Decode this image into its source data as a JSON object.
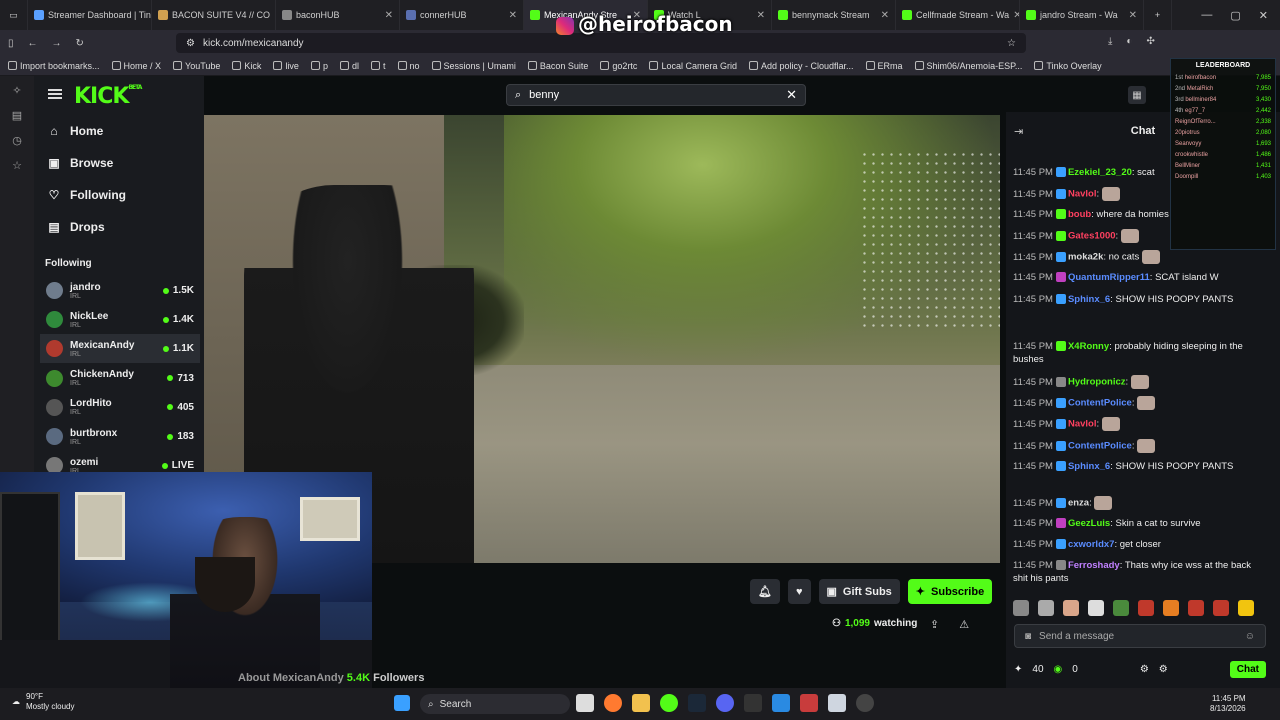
{
  "browser": {
    "tabs": [
      {
        "label": "Streamer Dashboard | Tinko",
        "color": "#5aa0ff"
      },
      {
        "label": "BACON SUITE V4 // CO",
        "color": "#d0a050"
      },
      {
        "label": "baconHUB",
        "color": "#888"
      },
      {
        "label": "connerHUB",
        "color": "#5a6fb0"
      },
      {
        "label": "MexicanAndy Stre",
        "color": "#53fc18"
      },
      {
        "label": "Watch L",
        "color": "#53fc18"
      },
      {
        "label": "bennymack Stream",
        "color": "#53fc18"
      },
      {
        "label": "Cellfmade Stream - Wa",
        "color": "#53fc18"
      },
      {
        "label": "jandro Stream - Wa",
        "color": "#53fc18"
      }
    ],
    "url": "kick.com/mexicanandy",
    "bookmarks": [
      "Import bookmarks...",
      "Home / X",
      "YouTube",
      "Kick",
      "live",
      "p",
      "dl",
      "t",
      "no",
      "Sessions | Umami",
      "Bacon Suite",
      "go2rtc",
      "Local Camera Grid",
      "Add policy - Cloudflar...",
      "ERma",
      "Shim06/Anemoia-ESP...",
      "Tinko Overlay"
    ]
  },
  "overlay": {
    "handle": "@heirofbacon"
  },
  "kick": {
    "logo": "KICK",
    "logo_tag": "BETA",
    "nav": [
      {
        "label": "Home",
        "icon": "home-icon",
        "glyph": "⌂"
      },
      {
        "label": "Browse",
        "icon": "browse-icon",
        "glyph": "▣"
      },
      {
        "label": "Following",
        "icon": "heart-icon",
        "glyph": "♡"
      },
      {
        "label": "Drops",
        "icon": "drops-icon",
        "glyph": "▤"
      }
    ],
    "following_title": "Following",
    "following": [
      {
        "name": "jandro",
        "cat": "IRL",
        "viewers": "1.5K",
        "color": "#6f7c8c"
      },
      {
        "name": "NickLee",
        "cat": "IRL",
        "viewers": "1.4K",
        "color": "#2f8a3c"
      },
      {
        "name": "MexicanAndy",
        "cat": "IRL",
        "viewers": "1.1K",
        "color": "#b03a2e"
      },
      {
        "name": "ChickenAndy",
        "cat": "IRL",
        "viewers": "713",
        "color": "#3d8a2e"
      },
      {
        "name": "LordHito",
        "cat": "IRL",
        "viewers": "405",
        "color": "#555"
      },
      {
        "name": "burtbronx",
        "cat": "IRL",
        "viewers": "183",
        "color": "#5a6a80"
      },
      {
        "name": "ozemi",
        "cat": "IRL",
        "viewers": "LIVE",
        "color": "#777"
      }
    ],
    "search_value": "benny",
    "actions": {
      "gift": "Gift Subs",
      "subscribe": "Subscribe"
    },
    "watching": "1,099",
    "watching_label": "watching",
    "about": "About MexicanAndy",
    "followers_count": "5.4K",
    "followers_label": "Followers"
  },
  "chat": {
    "title": "Chat",
    "messages": [
      {
        "time": "11:45 PM",
        "badge": "#3aa0ff",
        "user": "Ezekiel_23_20",
        "color": "#53fc18",
        "text": "scat",
        "emote": false
      },
      {
        "time": "11:45 PM",
        "badge": "#3aa0ff",
        "user": "Navlol",
        "color": "#ff4060",
        "text": "",
        "emote": true
      },
      {
        "time": "11:45 PM",
        "badge": "#53fc18",
        "user": "boub",
        "color": "#ff4060",
        "text": "where da homies",
        "emote": false
      },
      {
        "time": "11:45 PM",
        "badge": "#53fc18",
        "user": "Gates1000",
        "color": "#ff4060",
        "text": "",
        "emote": true
      },
      {
        "time": "11:45 PM",
        "badge": "#3aa0ff",
        "user": "moka2k",
        "color": "#dddddd",
        "text": "no cats",
        "emote": true
      },
      {
        "time": "11:45 PM",
        "badge": "#c040c0",
        "user": "QuantumRipper11",
        "color": "#5a8cff",
        "text": "SCAT island W",
        "emote": false
      },
      {
        "time": "11:45 PM",
        "badge": "#3aa0ff",
        "user": "Sphinx_6",
        "color": "#5a8cff",
        "text": "SHOW HIS POOPY PANTS",
        "emote": false
      },
      {
        "time": "11:45 PM",
        "badge": "#53fc18",
        "user": "X4Ronny",
        "color": "#53fc18",
        "text": "probably hiding sleeping in the bushes",
        "emote": false
      },
      {
        "time": "11:45 PM",
        "badge": "#888",
        "user": "Hydroponicz",
        "color": "#53fc18",
        "text": "",
        "emote": true
      },
      {
        "time": "11:45 PM",
        "badge": "#3aa0ff",
        "user": "ContentPolice",
        "color": "#5a8cff",
        "text": "",
        "emote": true
      },
      {
        "time": "11:45 PM",
        "badge": "#3aa0ff",
        "user": "Navlol",
        "color": "#ff4060",
        "text": "",
        "emote": true
      },
      {
        "time": "11:45 PM",
        "badge": "#3aa0ff",
        "user": "ContentPolice",
        "color": "#5a8cff",
        "text": "",
        "emote": true
      },
      {
        "time": "11:45 PM",
        "badge": "#3aa0ff",
        "user": "Sphinx_6",
        "color": "#5a8cff",
        "text": "SHOW HIS POOPY PANTS",
        "emote": false
      },
      {
        "time": "11:45 PM",
        "badge": "#3aa0ff",
        "user": "enza",
        "color": "#dddddd",
        "text": "",
        "emote": true
      },
      {
        "time": "11:45 PM",
        "badge": "#c040c0",
        "user": "GeezLuis",
        "color": "#53fc18",
        "text": "Skin a cat to survive",
        "emote": false
      },
      {
        "time": "11:45 PM",
        "badge": "#3aa0ff",
        "user": "cxworldx7",
        "color": "#5a8cff",
        "text": "get closer",
        "emote": false
      },
      {
        "time": "11:45 PM",
        "badge": "#888",
        "user": "Ferroshady",
        "color": "#c080ff",
        "text": "Thats why ice wss at the back shit his pants",
        "emote": false
      }
    ],
    "input_placeholder": "Send a message",
    "points": "40",
    "kicks": "0",
    "send_label": "Chat"
  },
  "leaderboard": {
    "title": "LEADERBOARD",
    "rows": [
      {
        "rank": "1st",
        "name": "heirofbacon",
        "val": "7,985"
      },
      {
        "rank": "2nd",
        "name": "MetalRich",
        "val": "7,950"
      },
      {
        "rank": "3rd",
        "name": "bellminer84",
        "val": "3,430"
      },
      {
        "rank": "4th",
        "name": "eg77_7",
        "val": "2,442"
      },
      {
        "rank": "",
        "name": "ReignOfTerro...",
        "val": "2,338"
      },
      {
        "rank": "",
        "name": "20piotrus",
        "val": "2,080"
      },
      {
        "rank": "",
        "name": "Seanvoyy",
        "val": "1,693"
      },
      {
        "rank": "",
        "name": "crookwhistle",
        "val": "1,486"
      },
      {
        "rank": "",
        "name": "BellMiner",
        "val": "1,431"
      },
      {
        "rank": "",
        "name": "Doompill",
        "val": "1,403"
      }
    ]
  },
  "taskbar": {
    "temp": "90°F",
    "weather": "Mostly cloudy",
    "search": "Search",
    "time": "11:45 PM",
    "date": "8/13/2026"
  }
}
